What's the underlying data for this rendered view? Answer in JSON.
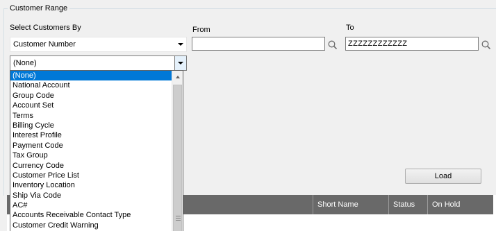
{
  "group": {
    "title": "Customer Range"
  },
  "select_by": {
    "label": "Select Customers By",
    "value": "Customer Number"
  },
  "from": {
    "label": "From",
    "value": ""
  },
  "to": {
    "label": "To",
    "value": "ZZZZZZZZZZZZ"
  },
  "second_combo": {
    "value": "(None)"
  },
  "dropdown": {
    "items": [
      "(None)",
      "National Account",
      "Group Code",
      "Account Set",
      "Terms",
      "Billing Cycle",
      "Interest Profile",
      "Payment Code",
      "Tax Group",
      "Currency Code",
      "Customer Price List",
      "Inventory Location",
      "Ship Via Code",
      "AC#",
      "Accounts Receivable Contact Type",
      "Customer Credit Warning"
    ],
    "selected_index": 0
  },
  "load_button": {
    "label": "Load"
  },
  "grid": {
    "columns": [
      "Short Name",
      "Status",
      "On Hold"
    ]
  },
  "colors": {
    "selection": "#0078d7",
    "grid_header": "#696969"
  },
  "icons": {
    "search": "search-icon",
    "dropdown_arrow": "chevron-down-icon",
    "scroll_up": "scroll-up-arrow-icon"
  }
}
